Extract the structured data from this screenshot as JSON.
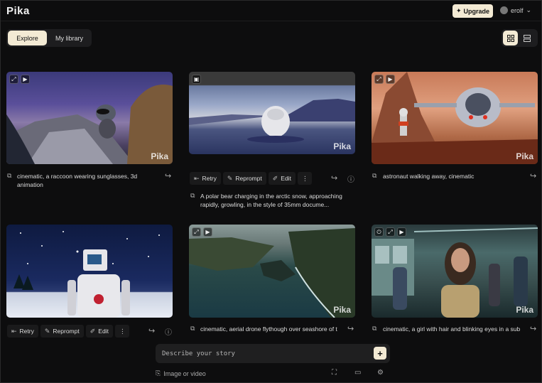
{
  "header": {
    "logo": "Pika",
    "upgrade_label": "Upgrade",
    "user_name": "erolf"
  },
  "tabs": [
    {
      "label": "Explore"
    },
    {
      "label": "My library"
    }
  ],
  "watermark": "Pika",
  "cards": [
    {
      "caption": "cinematic, a raccoon wearing sunglasses, 3d animation"
    },
    {
      "caption": "A polar bear charging in the arctic snow, approaching rapidly, growling, in the style of 35mm docume..."
    },
    {
      "caption": "astronaut walking away, cinematic"
    },
    {
      "caption": ""
    },
    {
      "caption": "cinematic, aerial drone flythough over seashore of t"
    },
    {
      "caption": "cinematic, a girl with hair and blinking eyes in a sub"
    }
  ],
  "actions": {
    "retry": "Retry",
    "reprompt": "Reprompt",
    "edit": "Edit"
  },
  "prompt": {
    "placeholder": "Describe your story"
  },
  "bottom": {
    "image_or_video": "Image or video"
  },
  "colors": {
    "accent": "#f3ead4",
    "background": "#0d0d0e"
  }
}
